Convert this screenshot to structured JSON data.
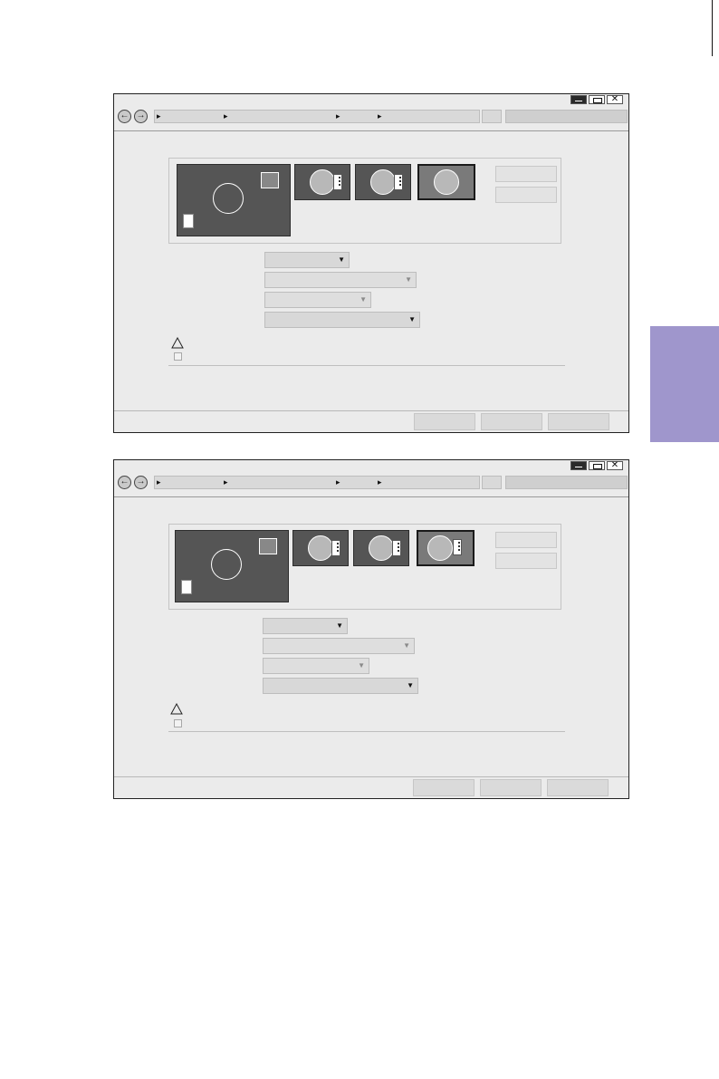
{
  "colors": {
    "side_tab": "#9f96cc",
    "window_bg": "#ebebeb",
    "display_dark": "#555555",
    "display_selected": "#7a7a7a"
  },
  "windows": [
    {
      "title_buttons": [
        "minimize-icon",
        "maximize-icon",
        "close-icon"
      ],
      "close_glyph": "✕",
      "nav": {
        "back_glyph": "←",
        "forward_glyph": "→",
        "crumb_glyph": "▸",
        "crumb_count": 4
      },
      "displays": 4,
      "selected_display": 4,
      "dropdowns": 4,
      "footer_buttons": 3,
      "warning_icon": "warning-triangle-icon"
    },
    {
      "title_buttons": [
        "minimize-icon",
        "maximize-icon",
        "close-icon"
      ],
      "close_glyph": "✕",
      "nav": {
        "back_glyph": "←",
        "forward_glyph": "→",
        "crumb_glyph": "▸",
        "crumb_count": 4
      },
      "displays": 4,
      "selected_display": 4,
      "dropdowns": 4,
      "footer_buttons": 3,
      "warning_icon": "warning-triangle-icon"
    }
  ]
}
